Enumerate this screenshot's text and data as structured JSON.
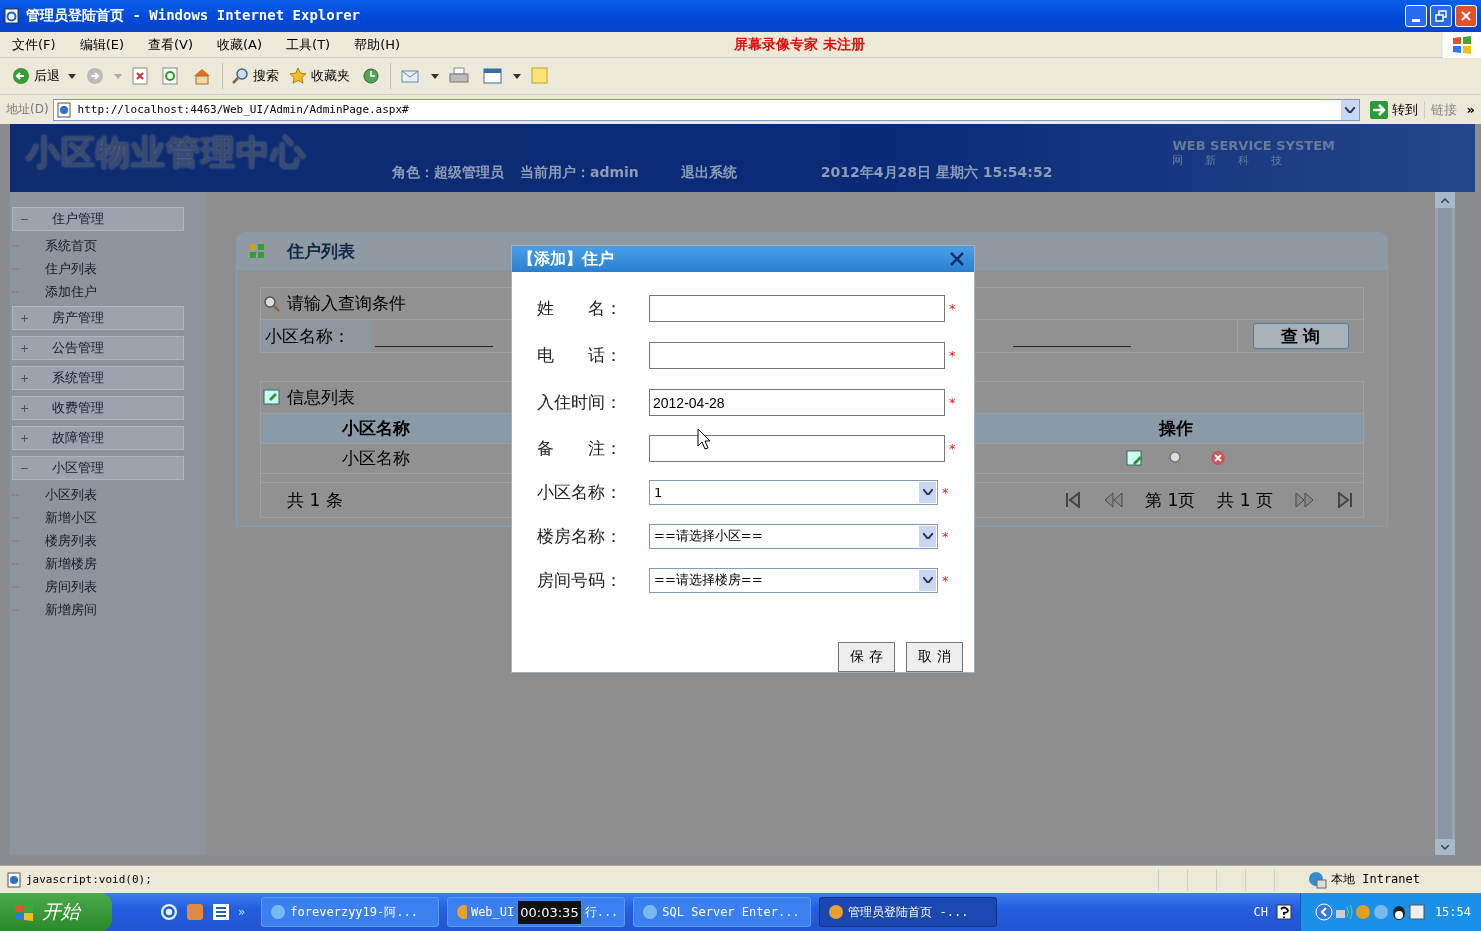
{
  "window": {
    "title": "管理员登陆首页 - Windows Internet Explorer"
  },
  "menu": {
    "items": [
      "文件(F)",
      "编辑(E)",
      "查看(V)",
      "收藏(A)",
      "工具(T)",
      "帮助(H)"
    ],
    "recorder_notice": "屏幕录像专家  未注册"
  },
  "toolbar": {
    "back": "后退",
    "search": "搜索",
    "favorites": "收藏夹"
  },
  "address_bar": {
    "label": "地址(D)",
    "url": "http://localhost:4463/Web_UI/Admin/AdminPage.aspx#",
    "go": "转到",
    "links": "链接",
    "more": "»"
  },
  "header": {
    "logo": "小区物业管理中心",
    "role": "角色：超级管理员",
    "user": "当前用户：admin",
    "logout": "退出系统",
    "datetime": "2012年4月28日 星期六  15:54:52",
    "brand": "WEB SERVICE SYSTEM",
    "brand_sub": "网　　新　　科　　技"
  },
  "sidebar": {
    "groups": [
      {
        "label": "住户管理",
        "expanded": true,
        "children": [
          "系统首页",
          "住户列表",
          "添加住户"
        ]
      },
      {
        "label": "房产管理",
        "expanded": false
      },
      {
        "label": "公告管理",
        "expanded": false
      },
      {
        "label": "系统管理",
        "expanded": false
      },
      {
        "label": "收费管理",
        "expanded": false
      },
      {
        "label": "故障管理",
        "expanded": false
      },
      {
        "label": "小区管理",
        "expanded": true,
        "children": [
          "小区列表",
          "新增小区",
          "楼房列表",
          "新增楼房",
          "房间列表",
          "新增房间"
        ]
      }
    ]
  },
  "panel": {
    "title": "住户列表",
    "query_title": "请输入查询条件",
    "query_label": "小区名称：",
    "query_button": "查 询",
    "list_title": "信息列表",
    "columns": [
      "小区名称",
      "操作"
    ],
    "rows": [
      {
        "cells": [
          "小区名称"
        ]
      }
    ],
    "total": "共 1 条",
    "page": "第 1页",
    "pages": "共 1 页"
  },
  "dialog": {
    "title": "【添加】住户",
    "fields": [
      {
        "label": "姓　　名：",
        "kind": "text",
        "required": "*"
      },
      {
        "label": "电　　话：",
        "kind": "text",
        "required": "*"
      },
      {
        "label": "入住时间：",
        "kind": "text",
        "value": "2012-04-28",
        "required": "*"
      },
      {
        "label": "备　　注：",
        "kind": "text",
        "required": "*"
      },
      {
        "label": "小区名称：",
        "kind": "select",
        "value": "1",
        "required": "*"
      },
      {
        "label": "楼房名称：",
        "kind": "select",
        "value": "==请选择小区==",
        "required": "*"
      },
      {
        "label": "房间号码：",
        "kind": "select",
        "value": "==请选择楼房==",
        "required": "*"
      }
    ],
    "buttons": [
      "保 存",
      "取 消"
    ]
  },
  "status_bar": {
    "text": "javascript:void(0);",
    "zone": "本地  Intranet"
  },
  "taskbar": {
    "start": "开始",
    "more": "»",
    "tasks": [
      {
        "label": "foreverzyy19-阿...",
        "selected": false
      },
      {
        "label": "Web_UI",
        "label_tail": "行...",
        "selected": false
      },
      {
        "label": "SQL Server Enter...",
        "selected": false
      },
      {
        "label": "管理员登陆首页 -...",
        "selected": true
      }
    ],
    "recorder_timer": "00:03:35",
    "language": "CH",
    "clock": "15:54"
  }
}
